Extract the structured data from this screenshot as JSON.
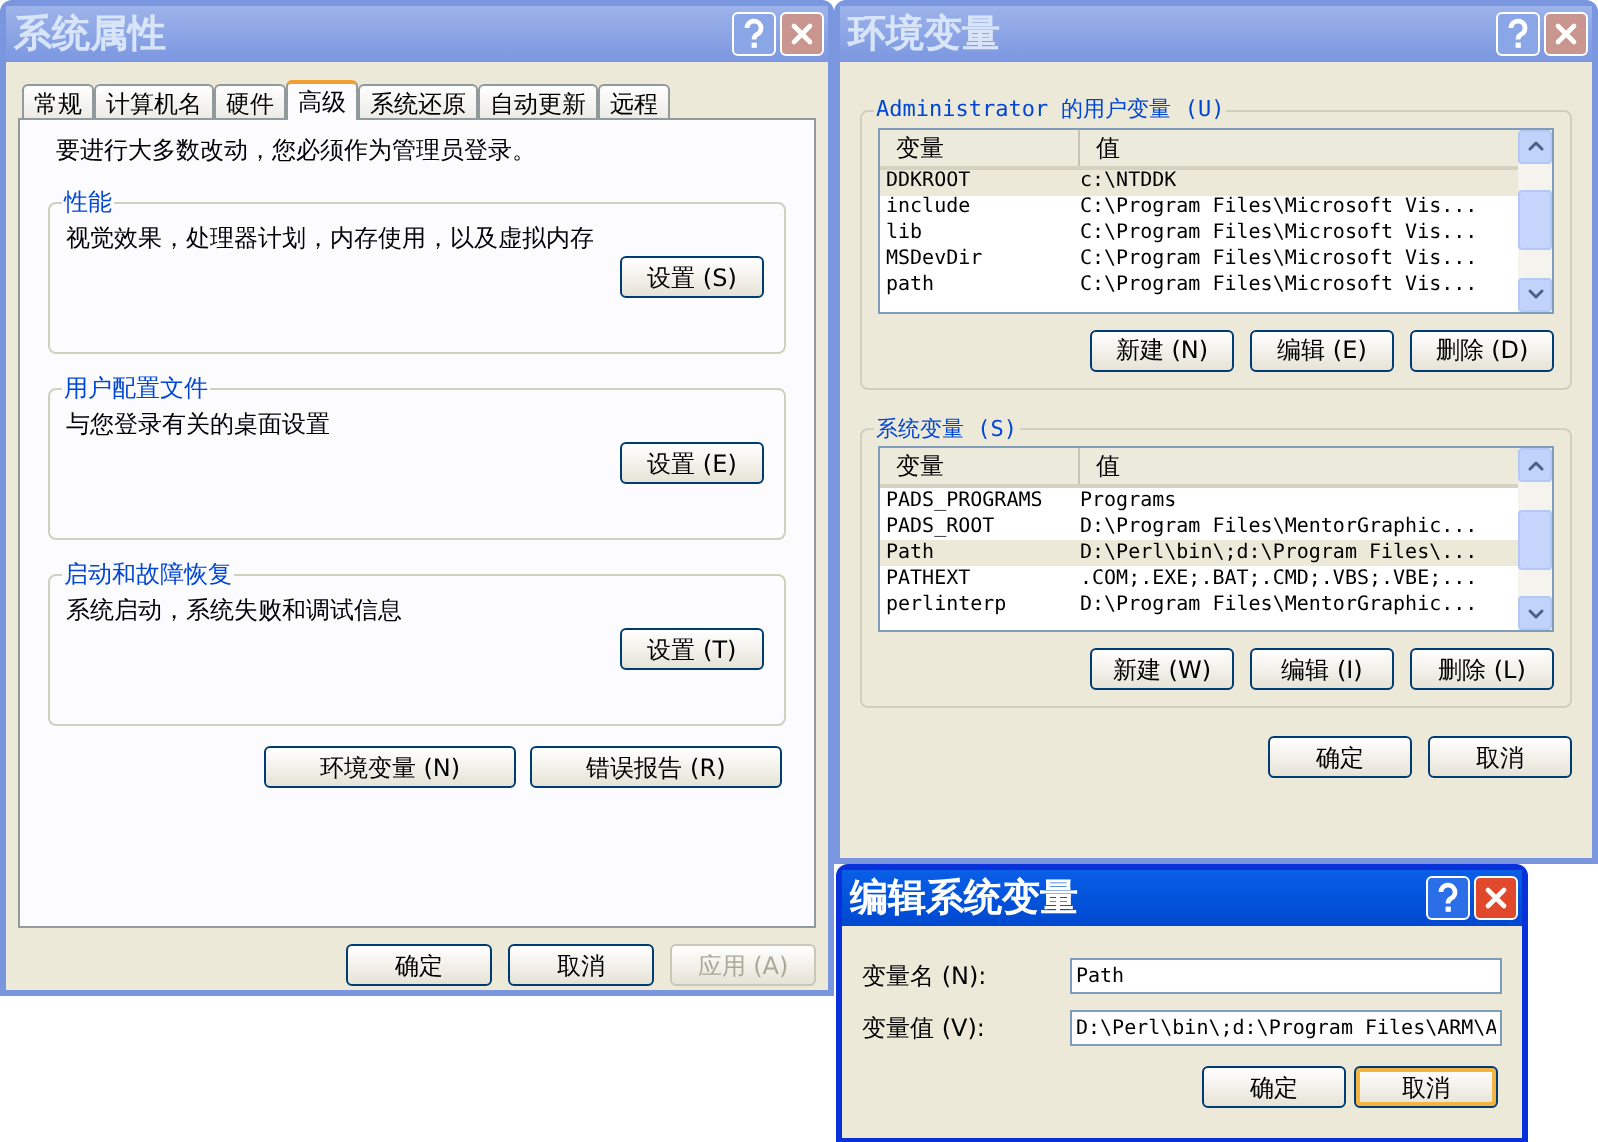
{
  "system_properties": {
    "title": "系统属性",
    "active": false,
    "tabs": [
      {
        "label": "常规",
        "selected": false
      },
      {
        "label": "计算机名",
        "selected": false
      },
      {
        "label": "硬件",
        "selected": false
      },
      {
        "label": "高级",
        "selected": true
      },
      {
        "label": "系统还原",
        "selected": false
      },
      {
        "label": "自动更新",
        "selected": false
      },
      {
        "label": "远程",
        "selected": false
      }
    ],
    "notice": "要进行大多数改动，您必须作为管理员登录。",
    "groups": [
      {
        "title": "性能",
        "description": "视觉效果，处理器计划，内存使用，以及虚拟内存",
        "button": "设置 (S)"
      },
      {
        "title": "用户配置文件",
        "description": "与您登录有关的桌面设置",
        "button": "设置 (E)"
      },
      {
        "title": "启动和故障恢复",
        "description": "系统启动，系统失败和调试信息",
        "button": "设置 (T)"
      }
    ],
    "action_buttons": [
      "环境变量 (N)",
      "错误报告 (R)"
    ],
    "dialog_buttons": [
      {
        "label": "确定",
        "disabled": false
      },
      {
        "label": "取消",
        "disabled": false
      },
      {
        "label": "应用 (A)",
        "disabled": true
      }
    ]
  },
  "environment_variables": {
    "title": "环境变量",
    "active": false,
    "lists": [
      {
        "title": "Administrator 的用户变量 (U)",
        "columns": [
          "变量",
          "值"
        ],
        "rows": [
          {
            "name": "DDKROOT",
            "value": "c:\\NTDDK",
            "selected": true
          },
          {
            "name": "include",
            "value": "C:\\Program Files\\Microsoft Vis...",
            "selected": false
          },
          {
            "name": "lib",
            "value": "C:\\Program Files\\Microsoft Vis...",
            "selected": false
          },
          {
            "name": "MSDevDir",
            "value": "C:\\Program Files\\Microsoft Vis...",
            "selected": false
          },
          {
            "name": "path",
            "value": "C:\\Program Files\\Microsoft Vis...",
            "selected": false
          }
        ],
        "buttons": [
          "新建 (N)",
          "编辑 (E)",
          "删除 (D)"
        ]
      },
      {
        "title": "系统变量 (S)",
        "columns": [
          "变量",
          "值"
        ],
        "rows": [
          {
            "name": "PADS_PROGRAMS",
            "value": "Programs",
            "selected": false
          },
          {
            "name": "PADS_ROOT",
            "value": "D:\\Program Files\\MentorGraphic...",
            "selected": false
          },
          {
            "name": "Path",
            "value": "D:\\Perl\\bin\\;d:\\Program Files\\...",
            "selected": true
          },
          {
            "name": "PATHEXT",
            "value": ".COM;.EXE;.BAT;.CMD;.VBS;.VBE;...",
            "selected": false
          },
          {
            "name": "perlinterp",
            "value": "D:\\Program Files\\MentorGraphic...",
            "selected": false
          }
        ],
        "buttons": [
          "新建 (W)",
          "编辑 (I)",
          "删除 (L)"
        ]
      }
    ],
    "buttons": [
      "确定",
      "取消"
    ]
  },
  "edit_dialog": {
    "title": "编辑系统变量",
    "active": true,
    "fields": [
      {
        "label": "变量名 (N):",
        "value": "Path"
      },
      {
        "label": "变量值 (V):",
        "value": "D:\\Perl\\bin\\;d:\\Program Files\\ARM\\A"
      }
    ],
    "buttons": [
      {
        "label": "确定",
        "focused": false
      },
      {
        "label": "取消",
        "focused": true
      }
    ]
  }
}
